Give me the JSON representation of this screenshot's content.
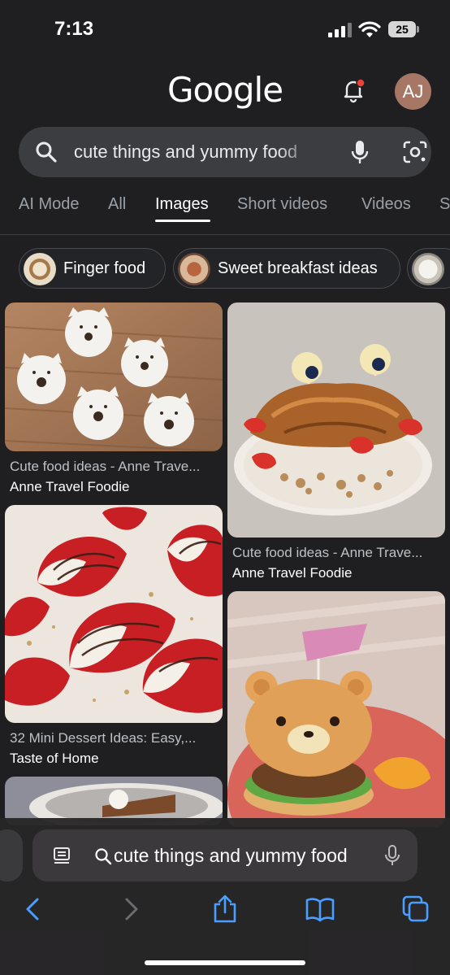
{
  "status_bar": {
    "time": "7:13",
    "battery": "25"
  },
  "header": {
    "logo": "Google",
    "avatar_initials": "AJ"
  },
  "search": {
    "query": "cute things and yummy food"
  },
  "tabs": [
    {
      "label": "AI Mode"
    },
    {
      "label": "All"
    },
    {
      "label": "Images",
      "active": true
    },
    {
      "label": "Short videos"
    },
    {
      "label": "Videos"
    },
    {
      "label": "S"
    }
  ],
  "chips": [
    {
      "label": "Finger food"
    },
    {
      "label": "Sweet breakfast ideas"
    },
    {
      "label": ""
    }
  ],
  "results": [
    {
      "title": "Cute food ideas - Anne Trave...",
      "source": "Anne Travel Foodie"
    },
    {
      "title": "Cute food ideas - Anne Trave...",
      "source": "Anne Travel Foodie"
    },
    {
      "title": "32 Mini Dessert Ideas: Easy,...",
      "source": "Taste of Home"
    }
  ],
  "browser_bar": {
    "url_text": "cute things and yummy food"
  },
  "colors": {
    "background": "#1f1f22",
    "search_bg": "#3c3d41",
    "link_blue": "#4a9eff",
    "notification_dot": "#ea4335"
  }
}
